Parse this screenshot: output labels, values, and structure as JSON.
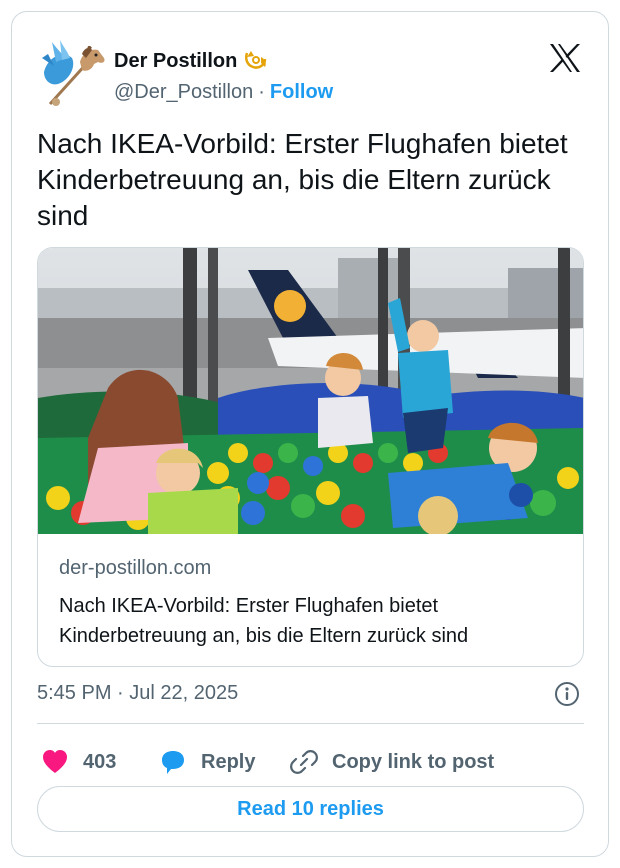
{
  "author": {
    "name": "Der Postillon",
    "handle": "@Der_Postillon",
    "separator": "·",
    "follow_label": "Follow"
  },
  "post": {
    "text": "Nach IKEA-Vorbild: Erster Flughafen bietet Kinderbetreuung an, bis die Eltern zurück sind",
    "timestamp": "5:45 PM · Jul 22, 2025"
  },
  "link_card": {
    "domain": "der-postillon.com",
    "title": "Nach IKEA-Vorbild: Erster Flughafen bietet Kinderbetreuung an, bis die Eltern zurück sind",
    "image_icon": "photo-children-ball-pit-airport"
  },
  "actions": {
    "like_count": "403",
    "reply_label": "Reply",
    "copy_label": "Copy link to post"
  },
  "read_replies_label": "Read 10 replies",
  "icons": {
    "platform": "x-logo-icon",
    "badge": "post-horn-icon",
    "info": "info-icon",
    "like": "heart-icon",
    "reply": "reply-bubble-icon",
    "copy": "link-icon"
  },
  "colors": {
    "accent": "#1d9bf0",
    "like": "#f91880",
    "text": "#0f1419",
    "muted": "#536471",
    "border": "#cfd9de"
  }
}
